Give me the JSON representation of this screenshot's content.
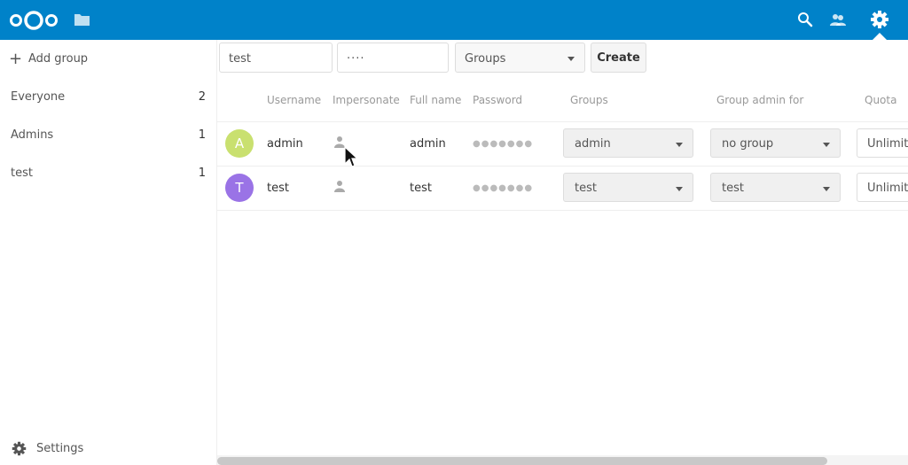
{
  "header": {
    "colors": {
      "background": "#0082c9",
      "icon": "#ffffff"
    },
    "icons": [
      "nextcloud-logo",
      "files-icon",
      "search-icon",
      "contacts-icon",
      "settings-gear-icon"
    ]
  },
  "sidebar": {
    "add_group_label": "Add group",
    "groups": [
      {
        "label": "Everyone",
        "count": "2"
      },
      {
        "label": "Admins",
        "count": "1"
      },
      {
        "label": "test",
        "count": "1"
      }
    ],
    "settings_label": "Settings"
  },
  "new_user_form": {
    "username_value": "test",
    "password_value": "····",
    "groups_placeholder": "Groups",
    "create_label": "Create"
  },
  "table": {
    "headers": [
      "Username",
      "Impersonate",
      "Full name",
      "Password",
      "Groups",
      "Group admin for",
      "Quota"
    ],
    "rows": [
      {
        "avatar_letter": "A",
        "avatar_color": "#c9e06f",
        "username": "admin",
        "full_name": "admin",
        "password": "●●●●●●●",
        "groups": "admin",
        "group_admin_for": "no group",
        "quota": "Unlimited"
      },
      {
        "avatar_letter": "T",
        "avatar_color": "#9a73e6",
        "username": "test",
        "full_name": "test",
        "password": "●●●●●●●",
        "groups": "test",
        "group_admin_for": "test",
        "quota": "Unlimited"
      }
    ]
  }
}
